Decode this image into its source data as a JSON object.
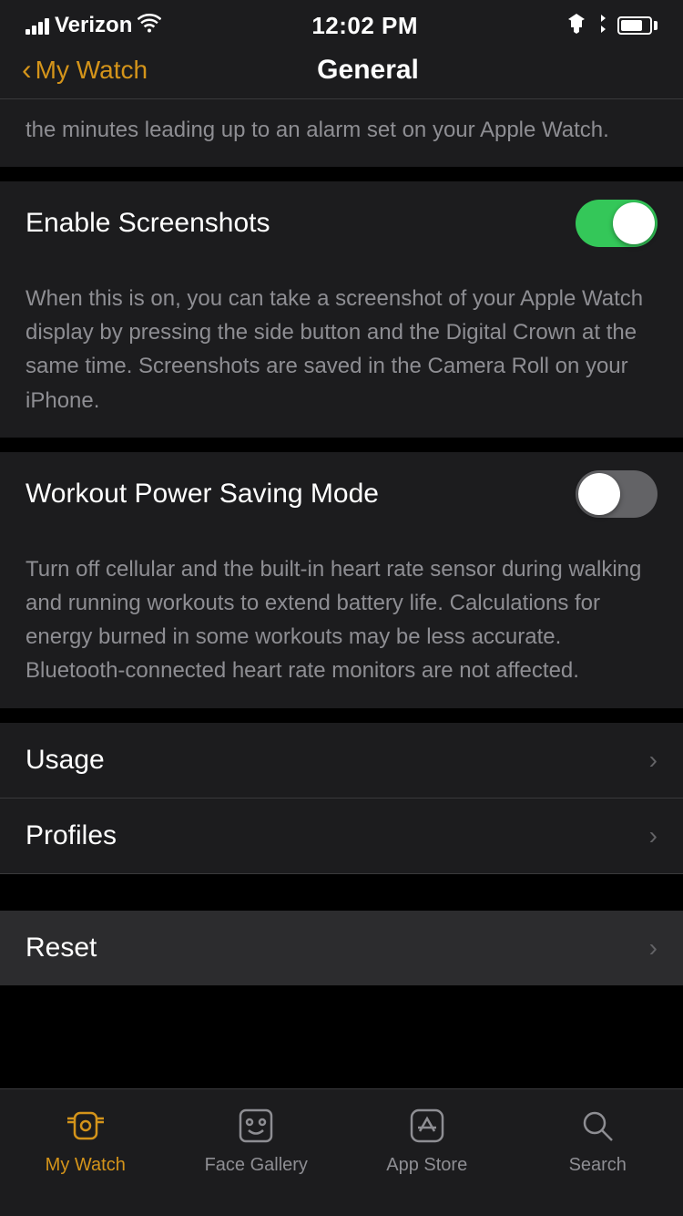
{
  "statusBar": {
    "carrier": "Verizon",
    "time": "12:02 PM"
  },
  "navBar": {
    "backLabel": "My Watch",
    "title": "General"
  },
  "partialText": "the minutes leading up to an alarm set on your Apple Watch.",
  "enableScreenshots": {
    "label": "Enable Screenshots",
    "state": "on",
    "description": "When this is on, you can take a screenshot of your Apple Watch display by pressing the side button and the Digital Crown at the same time. Screenshots are saved in the Camera Roll on your iPhone."
  },
  "workoutPowerSaving": {
    "label": "Workout Power Saving Mode",
    "state": "off",
    "description": "Turn off cellular and the built-in heart rate sensor during walking and running workouts to extend battery life. Calculations for energy burned in some workouts may be less accurate. Bluetooth-connected heart rate monitors are not affected."
  },
  "navItems": [
    {
      "label": "Usage"
    },
    {
      "label": "Profiles"
    }
  ],
  "resetItem": {
    "label": "Reset"
  },
  "tabBar": {
    "items": [
      {
        "id": "my-watch",
        "label": "My Watch",
        "active": true
      },
      {
        "id": "face-gallery",
        "label": "Face Gallery",
        "active": false
      },
      {
        "id": "app-store",
        "label": "App Store",
        "active": false
      },
      {
        "id": "search",
        "label": "Search",
        "active": false
      }
    ]
  }
}
